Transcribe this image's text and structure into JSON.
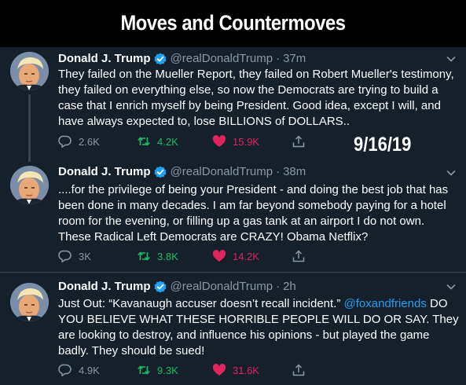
{
  "banner": {
    "title": "Moves and Countermoves"
  },
  "date_stamp": "9/16/19",
  "tweets": [
    {
      "name": "Donald J. Trump",
      "handle": "@realDonaldTrump",
      "separator": "·",
      "time": "37m",
      "text": "They failed on the Mueller Report, they failed on Robert Mueller's testimony, they failed on everything else, so now the Democrats are trying to build a case that I enrich myself by being President. Good idea, except I will, and have always expected to, lose BILLIONS of DOLLARS..",
      "replies": "2.6K",
      "retweets": "4.2K",
      "likes": "15.9K"
    },
    {
      "name": "Donald J. Trump",
      "handle": "@realDonaldTrump",
      "separator": "·",
      "time": "38m",
      "text": "....for the privilege of being your President - and doing the best job that has been done in many decades. I am far beyond somebody paying for a hotel room for the evening, or filling up a gas tank at an airport I do not own. These Radical Left Democrats are CRAZY! Obama Netflix?",
      "replies": "3K",
      "retweets": "3.8K",
      "likes": "14.2K"
    },
    {
      "name": "Donald J. Trump",
      "handle": "@realDonaldTrump",
      "separator": "·",
      "time": "2h",
      "text_before": "Just Out: “Kavanaugh accuser doesn’t recall incident.” ",
      "mention": "@foxandfriends",
      "text_after": "  DO YOU BELIEVE WHAT THESE HORRIBLE PEOPLE WILL DO OR SAY. They are looking to destroy, and influence his opinions - but played the game badly. They should be sued!",
      "replies": "4.9K",
      "retweets": "9.3K",
      "likes": "31.6K"
    }
  ],
  "icons": {
    "reply": "speech-bubble",
    "retweet": "retweet-arrows",
    "like": "heart",
    "share": "share-arrow-up",
    "verified": "verified-badge",
    "more": "chevron-down"
  },
  "colors": {
    "background": "#15202b",
    "secondary_text": "#8899a6",
    "retweet": "#17bf63",
    "like": "#e0245e",
    "link": "#1da1f2",
    "verified": "#1da1f2"
  }
}
